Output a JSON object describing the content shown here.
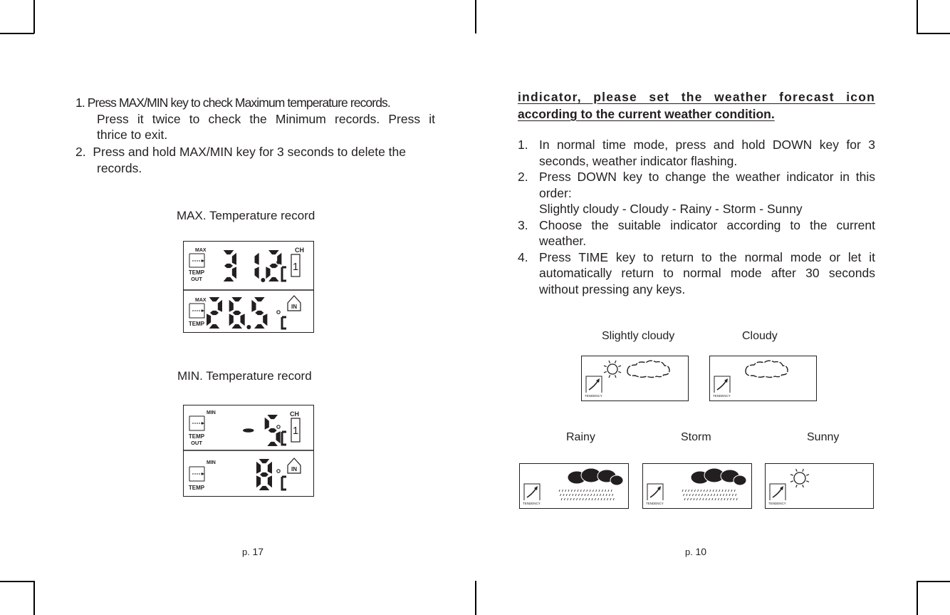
{
  "left_page": {
    "steps": [
      {
        "num": "1.",
        "first": "Press MAX/MIN key to check Maximum temperature records.",
        "line2": "Press it twice to check the Minimum records. Press it",
        "line3": "thrice to exit."
      },
      {
        "num": "2.",
        "first": "Press and hold MAX/MIN key for 3 seconds to delete the",
        "line2": "records."
      }
    ],
    "max_caption": "MAX. Temperature record",
    "min_caption": "MIN. Temperature record",
    "max_display": {
      "out_label_top": "MAX",
      "out_label_1": "TEMP",
      "out_label_2": "OUT",
      "out_value": "31.2",
      "unit": "°C",
      "channel_label": "CH",
      "channel_value": "1",
      "in_label_top": "MAX",
      "in_label_1": "TEMP",
      "in_value": "26.5",
      "in_badge": "IN"
    },
    "min_display": {
      "out_label_top": "MIN",
      "out_label_1": "TEMP",
      "out_label_2": "OUT",
      "out_value": "-5",
      "unit": "°C",
      "channel_label": "CH",
      "channel_value": "1",
      "in_label_top": "MIN",
      "in_label_1": "TEMP",
      "in_value": "8",
      "in_badge": "IN"
    },
    "page_prefix": "p.",
    "page_number": "17"
  },
  "right_page": {
    "heading_line1": "indicator, please set the weather forecast icon",
    "heading_line2": "according to the current weather condition.",
    "steps": [
      {
        "num": "1.",
        "lines": [
          "In normal time mode, press and hold DOWN key for 3",
          "seconds, weather indicator flashing."
        ]
      },
      {
        "num": "2.",
        "lines": [
          "Press DOWN key to change the weather indicator in this",
          "order:",
          "Slightly cloudy - Cloudy - Rainy - Storm - Sunny"
        ]
      },
      {
        "num": "3.",
        "lines": [
          "Choose the suitable indicator according to the current",
          "weather."
        ]
      },
      {
        "num": "4.",
        "lines": [
          "Press TIME key to return to the normal mode or let it",
          "automatically return to normal mode after 30 seconds",
          "without pressing any keys."
        ]
      }
    ],
    "weather_icons": [
      {
        "label": "Slightly cloudy",
        "tendency": "TENDENCY"
      },
      {
        "label": "Cloudy",
        "tendency": "TENDENCY"
      },
      {
        "label": "Rainy",
        "tendency": "TENDENCY"
      },
      {
        "label": "Storm",
        "tendency": "TENDENCY"
      },
      {
        "label": "Sunny",
        "tendency": "TENDENCY"
      }
    ],
    "page_prefix": "p.",
    "page_number": "10"
  }
}
